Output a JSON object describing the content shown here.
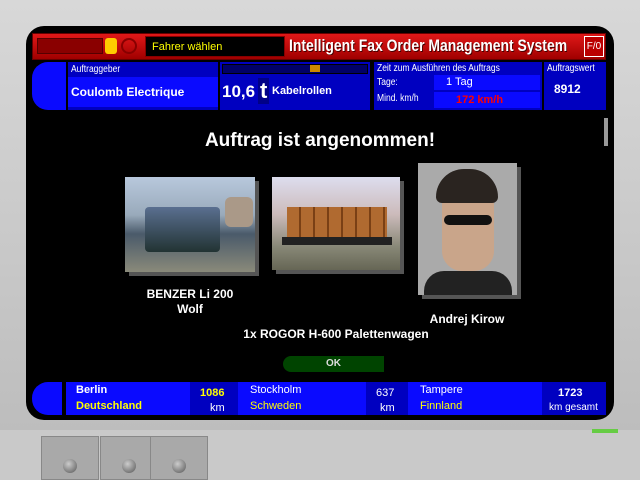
{
  "titlebar": {
    "driver_field": "Fahrer wählen",
    "title": "Intelligent Fax Order Management System",
    "fo_button": "F/0"
  },
  "order": {
    "client_label": "Auftraggeber",
    "client": "Coulomb Electrique",
    "weight": "10,6",
    "weight_unit": "t",
    "cargo": "Kabelrollen",
    "time_label": "Zeit zum Ausführen des Auftrags",
    "days_label": "Tage:",
    "days_value": "1 Tag",
    "speed_label": "Mind. km/h",
    "speed_value": "172 km/h",
    "value_label": "Auftragswert",
    "value": "8912"
  },
  "main": {
    "heading": "Auftrag ist angenommen!",
    "truck_name": "BENZER Li 200",
    "truck_sub": "Wolf",
    "trailer": "1x ROGOR H-600 Palettenwagen",
    "driver": "Andrej Kirow",
    "ok": "OK"
  },
  "route": {
    "from_city": "Berlin",
    "from_country": "Deutschland",
    "dist1": "1086",
    "unit": "km",
    "via_city": "Stockholm",
    "via_country": "Schweden",
    "dist2": "637",
    "to_city": "Tampere",
    "to_country": "Finnland",
    "total": "1723",
    "total_unit": "km gesamt"
  }
}
